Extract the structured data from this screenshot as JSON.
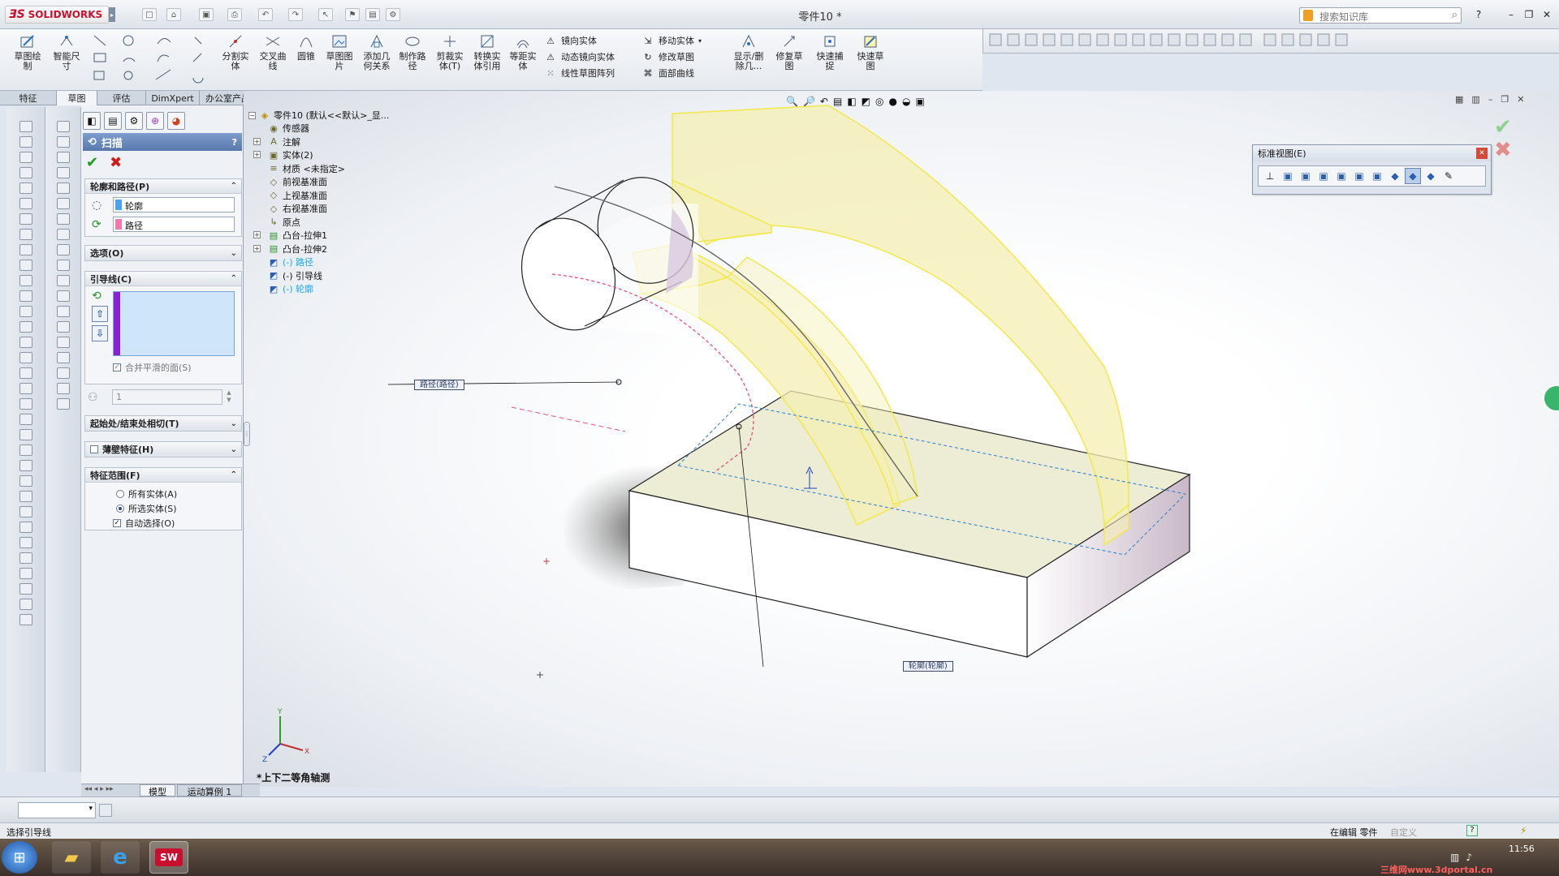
{
  "app": {
    "logo_text": "SOLIDWORKS",
    "document_title": "零件10 *",
    "search_placeholder": "搜索知识库",
    "help_label": "?",
    "window_controls": {
      "minimize": "–",
      "restore": "❐",
      "close": "✕"
    }
  },
  "command_manager": {
    "tools": [
      {
        "id": "sketch",
        "label": "草图绘\n制",
        "icon": "sketch-icon"
      },
      {
        "id": "smart-dim",
        "label": "智能尺\n寸",
        "icon": "dimension-icon"
      },
      {
        "id": "split-entity",
        "label": "分割实\n体",
        "icon": "split-icon"
      },
      {
        "id": "intersection",
        "label": "交叉曲\n线",
        "icon": "intersection-curve-icon"
      },
      {
        "id": "ellipse",
        "label": "圆锥",
        "icon": "conic-icon"
      },
      {
        "id": "sketch-picture",
        "label": "草图图\n片",
        "icon": "picture-icon"
      },
      {
        "id": "add-relation",
        "label": "添加几\n何关系",
        "icon": "relation-icon"
      },
      {
        "id": "make-path",
        "label": "制作路\n径",
        "icon": "path-icon"
      },
      {
        "id": "trim",
        "label": "剪裁实\n体(T)",
        "icon": "trim-icon"
      },
      {
        "id": "convert",
        "label": "转换实\n体引用",
        "icon": "convert-icon"
      },
      {
        "id": "offset",
        "label": "等距实\n体",
        "icon": "offset-icon"
      },
      {
        "id": "display-delete",
        "label": "显示/删\n除几...",
        "icon": "display-delete-icon"
      },
      {
        "id": "repair-sketch",
        "label": "修复草\n图",
        "icon": "repair-icon"
      },
      {
        "id": "quick-snap",
        "label": "快速捕\n捉",
        "icon": "snap-icon"
      },
      {
        "id": "rapid-sketch",
        "label": "快速草\n图",
        "icon": "rapid-sketch-icon"
      }
    ],
    "row_tools": [
      {
        "id": "mirror",
        "label": "镜向实体"
      },
      {
        "id": "dynamic-mirror",
        "label": "动态镜向实体"
      },
      {
        "id": "linear-pattern",
        "label": "线性草图阵列"
      },
      {
        "id": "move",
        "label": "移动实体"
      },
      {
        "id": "modify-sketch",
        "label": "修改草图"
      },
      {
        "id": "face-curves",
        "label": "面部曲线"
      }
    ]
  },
  "tabs": [
    "特征",
    "草图",
    "评估",
    "DimXpert",
    "办公室产品"
  ],
  "active_tab": "草图",
  "property_manager": {
    "title": "扫描",
    "help": "?",
    "groups": {
      "profile_path": {
        "title": "轮廓和路径(P)",
        "profile": "轮廓",
        "path": "路径"
      },
      "options": {
        "title": "选项(O)"
      },
      "guides": {
        "title": "引导线(C)",
        "merge_smooth": "合并平滑的面(S)",
        "count": "1"
      },
      "tangency": {
        "title": "起始处/结束处相切(T)"
      },
      "thin": {
        "title": "薄壁特征(H)"
      },
      "scope": {
        "title": "特征范围(F)",
        "all_bodies": "所有实体(A)",
        "selected_bodies": "所选实体(S)",
        "auto_select": "自动选择(O)"
      }
    }
  },
  "tree": {
    "root": "零件10 (默认<<默认>_显...",
    "items": [
      {
        "label": "传感器",
        "icon": "sensor-icon",
        "expand": false
      },
      {
        "label": "注解",
        "icon": "annotation-icon",
        "expand": true
      },
      {
        "label": "实体(2)",
        "icon": "solid-bodies-icon",
        "expand": true
      },
      {
        "label": "材质 <未指定>",
        "icon": "material-icon",
        "expand": false
      },
      {
        "label": "前视基准面",
        "icon": "plane-icon",
        "expand": false
      },
      {
        "label": "上视基准面",
        "icon": "plane-icon",
        "expand": false
      },
      {
        "label": "右视基准面",
        "icon": "plane-icon",
        "expand": false
      },
      {
        "label": "原点",
        "icon": "origin-icon",
        "expand": false
      },
      {
        "label": "凸台-拉伸1",
        "icon": "extrude-icon",
        "expand": true
      },
      {
        "label": "凸台-拉伸2",
        "icon": "extrude-icon",
        "expand": true
      },
      {
        "label": "(-) 路径",
        "icon": "sketch-icon",
        "expand": false,
        "highlight": true
      },
      {
        "label": "(-) 引导线",
        "icon": "sketch-icon",
        "expand": false,
        "highlight": false
      },
      {
        "label": "(-) 轮廓",
        "icon": "sketch-icon",
        "expand": false,
        "highlight": true
      }
    ]
  },
  "viewport": {
    "path_callout": "路径(路径)",
    "profile_callout": "轮廓(轮廓)",
    "view_name": "*上下二等角轴测",
    "standard_views_title": "标准视图(E)"
  },
  "bottom": {
    "model_tabs": [
      "模型",
      "运动算例 1"
    ],
    "status_left": "选择引导线",
    "status_right": "在编辑 零件",
    "status_custom": "自定义",
    "clock": "11:56",
    "watermark": "三维网www.3dportal.cn"
  },
  "colors": {
    "yellow_edge": "#f2e84a",
    "surface_fill": "#f4efb3",
    "path_pink": "#e05080",
    "guide_purple": "#8b1fd6",
    "accent_blue": "#2b5fb3"
  }
}
